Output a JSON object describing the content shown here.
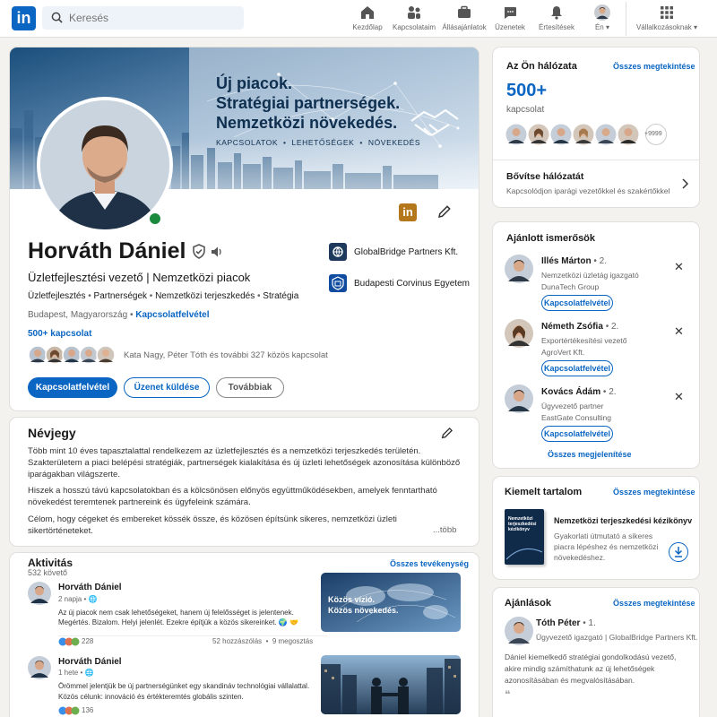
{
  "nav": {
    "logo": "in",
    "search_placeholder": "Keresés",
    "items": [
      {
        "label": "Kezdőlap",
        "icon": "home-icon"
      },
      {
        "label": "Kapcsolataim",
        "icon": "network-icon"
      },
      {
        "label": "Állásajánlatok",
        "icon": "jobs-icon"
      },
      {
        "label": "Üzenetek",
        "icon": "messaging-icon"
      },
      {
        "label": "Értesítések",
        "icon": "bell-icon"
      },
      {
        "label": "Én",
        "icon": "me-avatar"
      },
      {
        "label": "Vállalkozásoknak",
        "icon": "grid-icon"
      }
    ]
  },
  "banner": {
    "line1": "Új piacok.",
    "line2": "Stratégiai partnerségek.",
    "line3": "Nemzetközi növekedés.",
    "tagline": "KAPCSOLATOK  •  LEHETŐSÉGEK  •  NÖVEKEDÉS"
  },
  "profile": {
    "name": "Horváth Dániel",
    "headline": "Üzletfejlesztési vezető | Nemzetközi piacok",
    "skills": [
      "Üzletfejlesztés",
      "Partnerségek",
      "Nemzetközi terjeszkedés",
      "Stratégia"
    ],
    "location": "Budapest, Magyarország",
    "contact_link": "Kapcsolatfelvétel",
    "connections": "500+ kapcsolat",
    "mutual": "Kata Nagy, Péter Tóth és további 327 közös kapcsolat",
    "company": "GlobalBridge Partners Kft.",
    "school": "Budapesti Corvinus Egyetem",
    "buttons": {
      "connect": "Kapcsolatfelvétel",
      "message": "Üzenet küldése",
      "more": "Továbbiak"
    }
  },
  "about": {
    "title": "Névjegy",
    "p1": "Több mint 10 éves tapasztalattal rendelkezem az üzletfejlesztés és a nemzetközi terjeszkedés területén. Szakterületem a piaci belépési stratégiák, partnerségek kialakítása és új üzleti lehetőségek azonosítása különböző iparágakban világszerte.",
    "p2": "Hiszek a hosszú távú kapcsolatokban és a kölcsönösen előnyös együttműködésekben, amelyek fenntartható növekedést teremtenek partnereink és ügyfeleink számára.",
    "p3": "Célom, hogy cégeket és embereket kössék össze, és közösen építsünk sikeres, nemzetközi üzleti sikertörténeteket.",
    "more": "...több"
  },
  "activity": {
    "title": "Aktivitás",
    "followers": "532 követő",
    "all_link": "Összes tevékenység",
    "posts": [
      {
        "author": "Horváth Dániel",
        "time": "2 napja",
        "text1": "Az új piacok nem csak lehetőségeket, hanem új felelősséget is jelentenek.",
        "text2": "Megértés. Bizalom. Helyi jelenlét. Ezekre építjük a közös sikereinket. 🌍 🤝",
        "reactions": "228",
        "stats": "52 hozzászólás  •  9 megosztás",
        "image_text": "Közös vízió.\nKözös növekedés."
      },
      {
        "author": "Horváth Dániel",
        "time": "1 hete",
        "text1": "Örömmel jelentjük be új partnerségünket egy skandináv technológiai vállalattal.",
        "text2": "Közös célunk: innováció és értékteremtés globális szinten.",
        "reactions": "136"
      }
    ]
  },
  "network": {
    "title": "Az Ön hálózata",
    "see_all": "Összes megtekintése",
    "count": "500+",
    "count_label": "kapcsolat",
    "more_badge": "+9999",
    "expand_title": "Bővítse hálózatát",
    "expand_sub": "Kapcsolódjon iparági vezetőkkel és szakértőkkel"
  },
  "suggestions": {
    "title": "Ajánlott ismerősök",
    "people": [
      {
        "name": "Illés Márton",
        "degree": "• 2.",
        "role": "Nemzetközi üzletág igazgató",
        "company": "DunaTech Group",
        "btn": "Kapcsolatfelvétel"
      },
      {
        "name": "Németh Zsófia",
        "degree": "• 2.",
        "role": "Exportértékesítési vezető",
        "company": "AgroVert Kft.",
        "btn": "Kapcsolatfelvétel"
      },
      {
        "name": "Kovács Ádám",
        "degree": "• 2.",
        "role": "Ügyvezető partner",
        "company": "EastGate Consulting",
        "btn": "Kapcsolatfelvétel"
      }
    ],
    "see_all": "Összes megjelenítése"
  },
  "featured": {
    "title": "Kiemelt tartalom",
    "see_all": "Összes megtekintése",
    "book_title": "Nemzetközi terjeszkedési kézikönyv",
    "book_desc": "Gyakorlati útmutató a sikeres piacra lépéshez és nemzetközi növekedéshez.",
    "book_cover": "Nemzetközi terjeszkedési kézikönyv"
  },
  "recommendations": {
    "title": "Ajánlások",
    "see_all": "Összes megtekintése",
    "name": "Tóth Péter",
    "degree": "• 1.",
    "role": "Ügyvezető igazgató | GlobalBridge Partners Kft.",
    "text": "Dániel kiemelkedő stratégiai gondolkodású vezető, akire mindig számíthatunk az új lehetőségek azonosításában és megvalósításában."
  },
  "colors": {
    "brand": "#0a66c2",
    "online": "#1a8a3c"
  }
}
